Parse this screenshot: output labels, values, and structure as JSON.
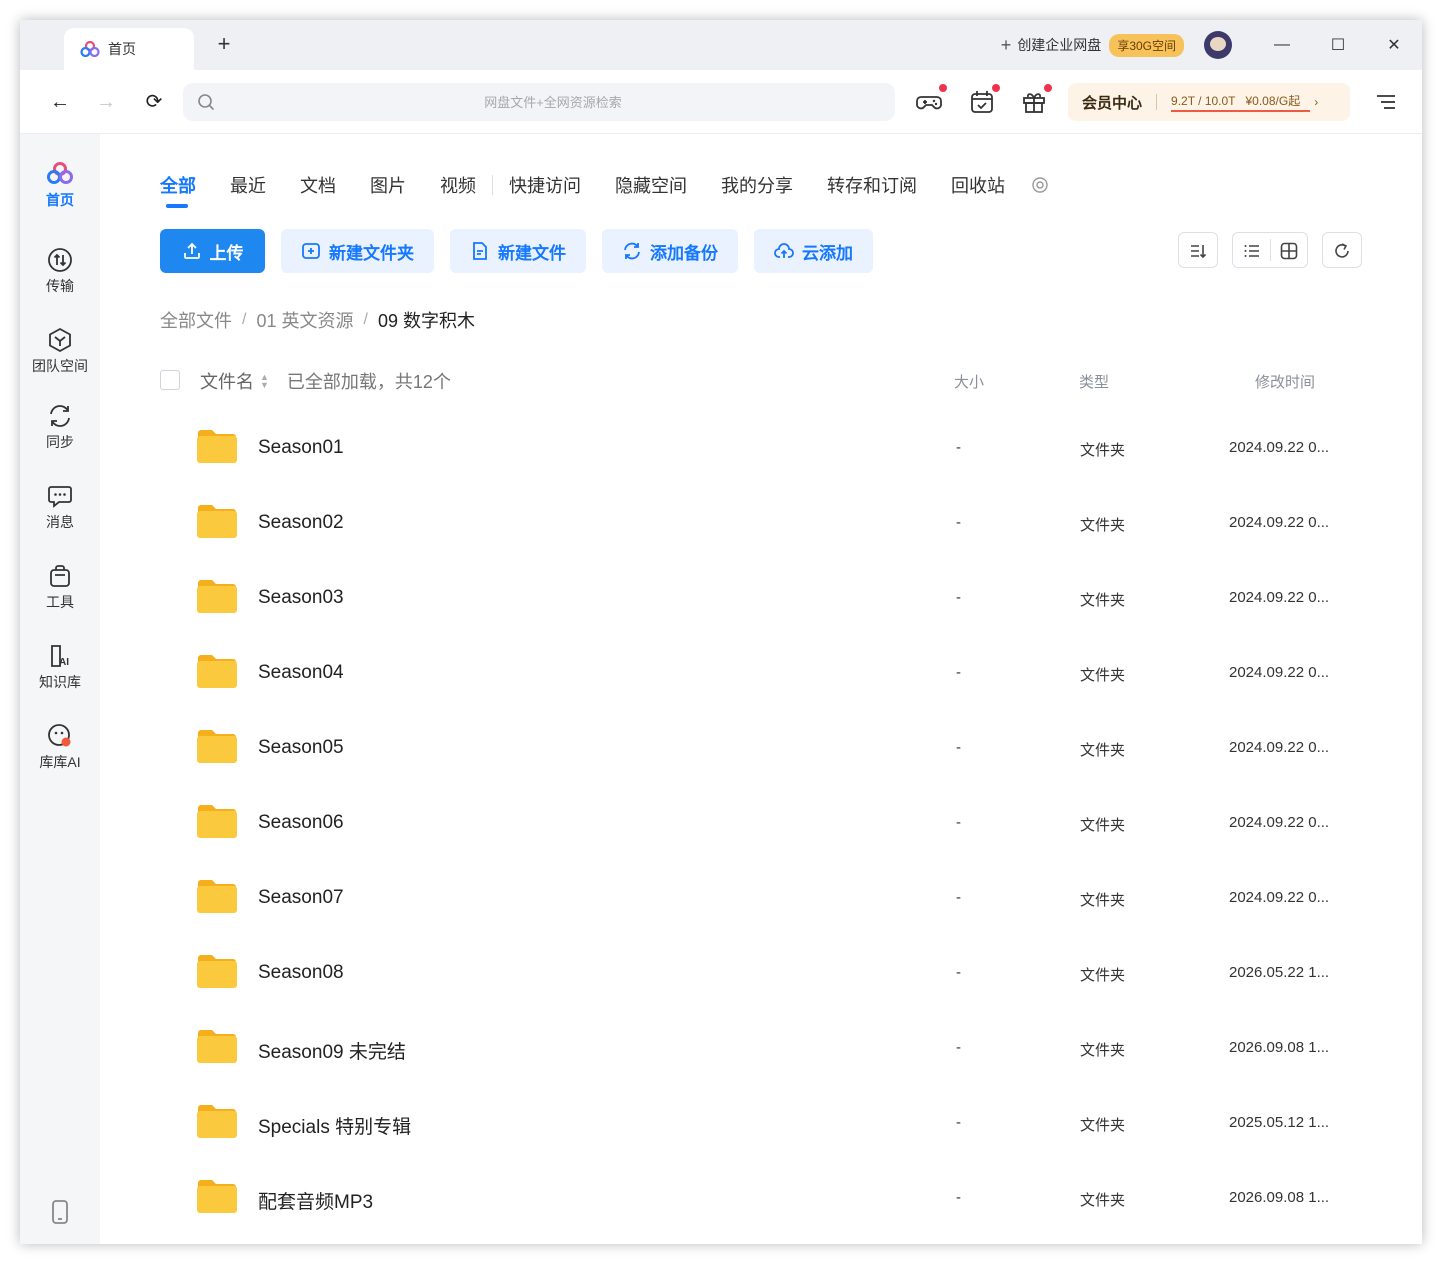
{
  "titlebar": {
    "tab_label": "首页",
    "new_tab": "+",
    "create_enterprise": "创建企业网盘",
    "enterprise_badge": "享30G空间",
    "minimize": "—",
    "maximize": "☐",
    "close": "✕"
  },
  "addressbar": {
    "back": "←",
    "forward": "→",
    "reload": "⟳",
    "search_placeholder": "网盘文件+全网资源检索",
    "vip_title": "会员中心",
    "vip_storage": "9.2T / 10.0T",
    "vip_price": "¥0.08/G起",
    "vip_chevron": "›"
  },
  "sidebar": {
    "items": [
      {
        "label": "首页",
        "icon": "cloud-logo-icon"
      },
      {
        "label": "传输",
        "icon": "transfer-icon"
      },
      {
        "label": "团队空间",
        "icon": "team-icon"
      },
      {
        "label": "同步",
        "icon": "sync-icon"
      },
      {
        "label": "消息",
        "icon": "message-icon"
      },
      {
        "label": "工具",
        "icon": "tools-icon"
      },
      {
        "label": "知识库",
        "icon": "knowledge-icon"
      },
      {
        "label": "库库AI",
        "icon": "ai-icon"
      }
    ]
  },
  "tabs": [
    "全部",
    "最近",
    "文档",
    "图片",
    "视频",
    "快捷访问",
    "隐藏空间",
    "我的分享",
    "转存和订阅",
    "回收站"
  ],
  "actions": {
    "upload": "上传",
    "new_folder": "新建文件夹",
    "new_file": "新建文件",
    "add_backup": "添加备份",
    "cloud_add": "云添加"
  },
  "breadcrumb": [
    "全部文件",
    "01 英文资源",
    "09 数字积木"
  ],
  "breadcrumb_sep": "/",
  "table": {
    "col_name": "文件名",
    "loaded_text": "已全部加载，共12个",
    "col_size": "大小",
    "col_type": "类型",
    "col_mtime": "修改时间",
    "rows": [
      {
        "name": "Season01",
        "size": "-",
        "type": "文件夹",
        "mtime": "2024.09.22 0..."
      },
      {
        "name": "Season02",
        "size": "-",
        "type": "文件夹",
        "mtime": "2024.09.22 0..."
      },
      {
        "name": "Season03",
        "size": "-",
        "type": "文件夹",
        "mtime": "2024.09.22 0..."
      },
      {
        "name": "Season04",
        "size": "-",
        "type": "文件夹",
        "mtime": "2024.09.22 0..."
      },
      {
        "name": "Season05",
        "size": "-",
        "type": "文件夹",
        "mtime": "2024.09.22 0..."
      },
      {
        "name": "Season06",
        "size": "-",
        "type": "文件夹",
        "mtime": "2024.09.22 0..."
      },
      {
        "name": "Season07",
        "size": "-",
        "type": "文件夹",
        "mtime": "2024.09.22 0..."
      },
      {
        "name": "Season08",
        "size": "-",
        "type": "文件夹",
        "mtime": "2026.05.22 1..."
      },
      {
        "name": "Season09 未完结",
        "size": "-",
        "type": "文件夹",
        "mtime": "2026.09.08 1..."
      },
      {
        "name": "Specials 特别专辑",
        "size": "-",
        "type": "文件夹",
        "mtime": "2025.05.12 1..."
      },
      {
        "name": "配套音频MP3",
        "size": "-",
        "type": "文件夹",
        "mtime": "2026.09.08 1..."
      }
    ]
  },
  "colors": {
    "accent": "#1677ff",
    "primary_button": "#1e88f0",
    "secondary_button_bg": "#e9f2fe",
    "folder": "#fbc53a",
    "notification_dot": "#f0324f"
  }
}
